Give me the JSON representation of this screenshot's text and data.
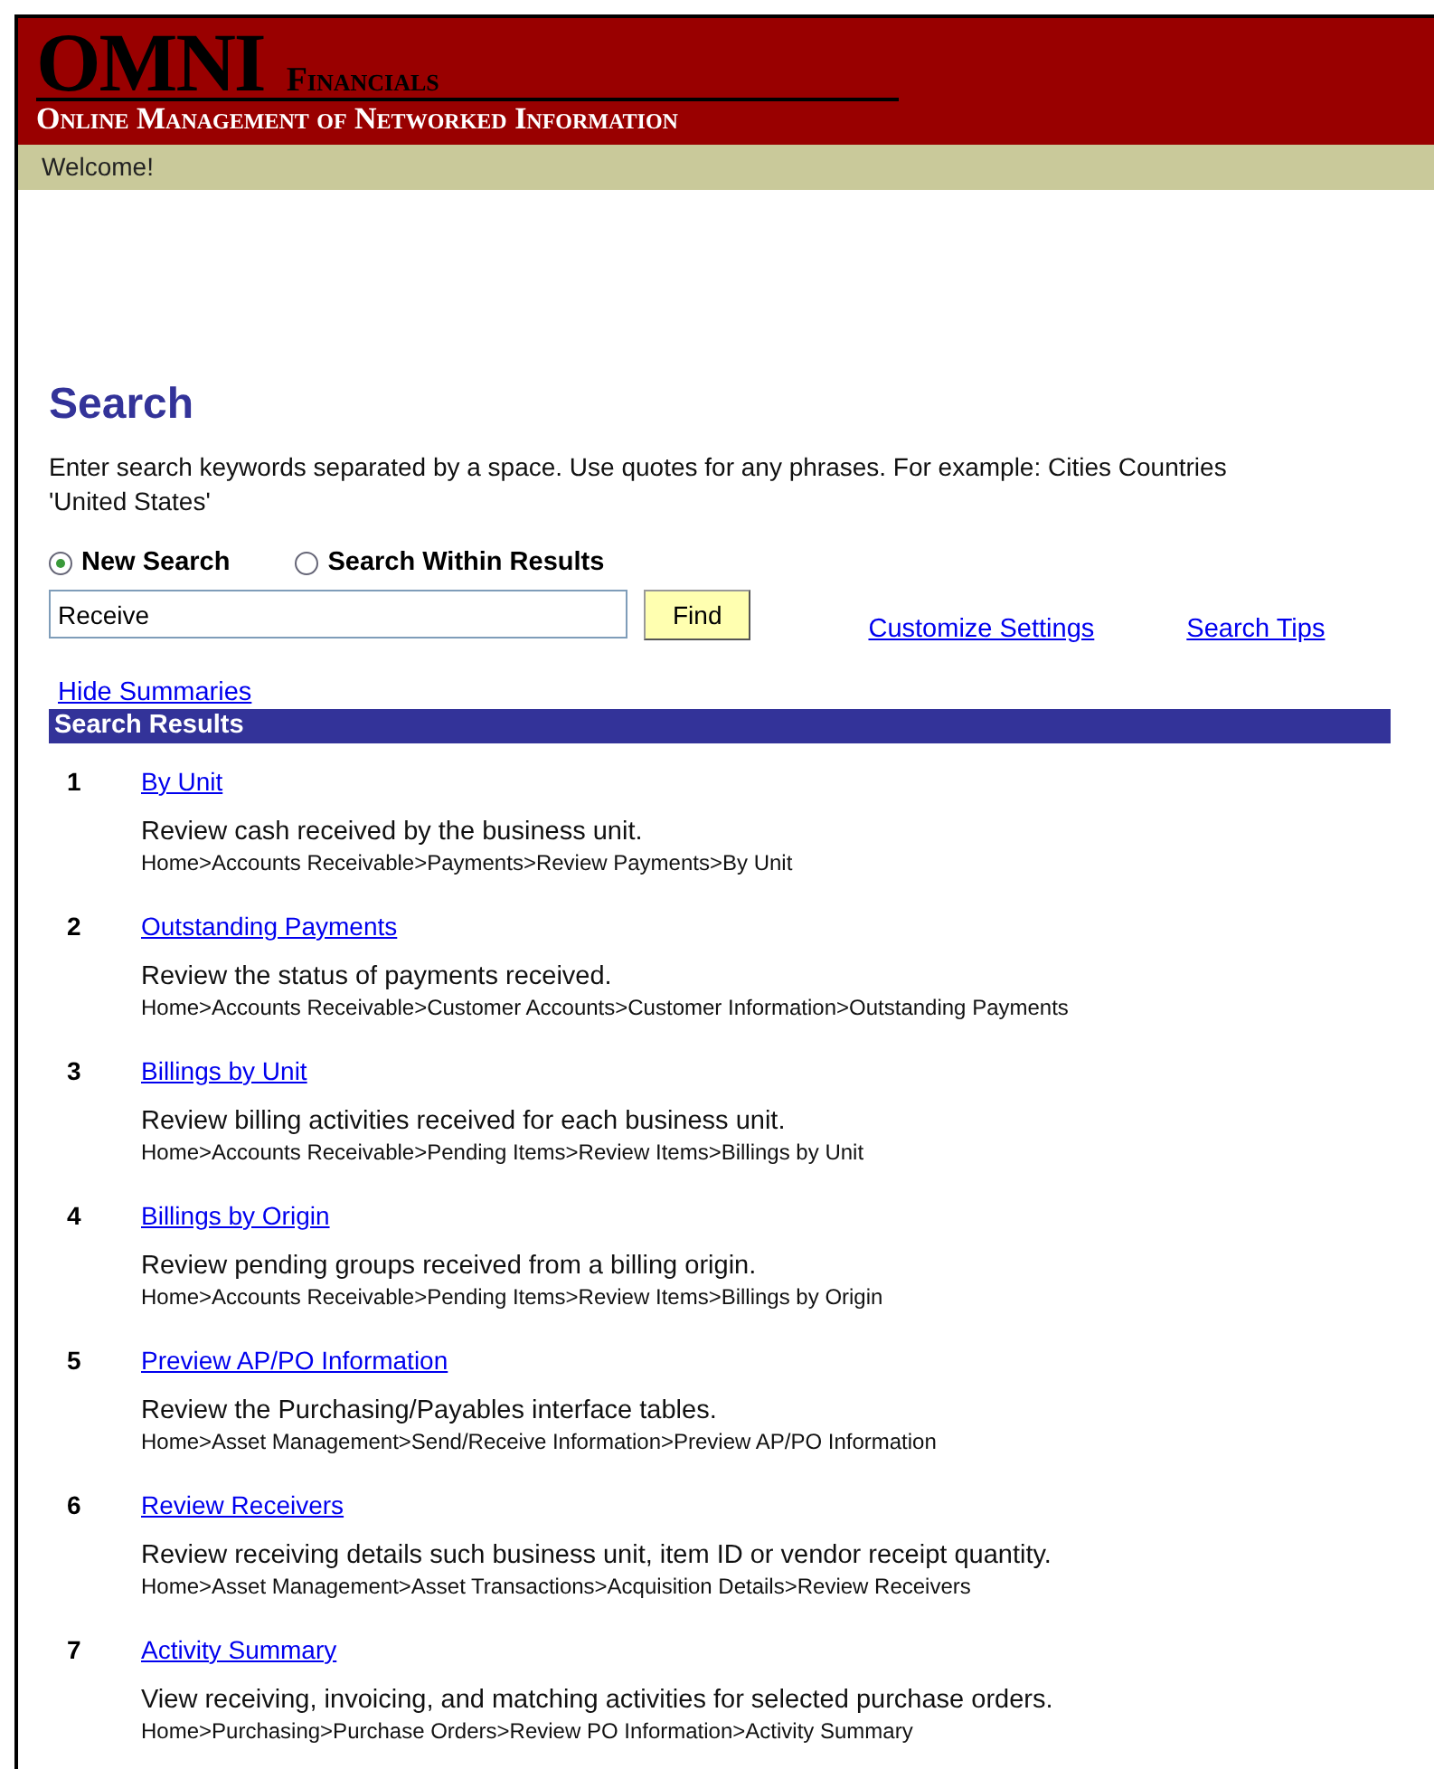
{
  "header": {
    "logo": "OMNI",
    "logo_suffix": "Financials",
    "tagline": "Online Management of Networked Information"
  },
  "welcome": "Welcome!",
  "search": {
    "title": "Search",
    "instructions": "Enter search keywords separated by a space. Use quotes for any phrases. For example: Cities Countries 'United States'",
    "modes": [
      {
        "label": "New Search",
        "selected": true
      },
      {
        "label": "Search Within Results",
        "selected": false
      }
    ],
    "value": "Receive",
    "find_button": "Find",
    "links": [
      "Customize Settings",
      "Search Tips"
    ]
  },
  "hide_summaries": "Hide Summaries",
  "results_header": "Search Results",
  "results": [
    {
      "number": "1",
      "title": "By Unit",
      "summary": "Review cash received by the business unit.",
      "path": "Home>Accounts Receivable>Payments>Review Payments>By Unit"
    },
    {
      "number": "2",
      "title": "Outstanding Payments",
      "summary": "Review the status of payments received.",
      "path": "Home>Accounts Receivable>Customer Accounts>Customer Information>Outstanding Payments"
    },
    {
      "number": "3",
      "title": "Billings by Unit",
      "summary": "Review billing activities received for each business unit.",
      "path": "Home>Accounts Receivable>Pending Items>Review Items>Billings by Unit"
    },
    {
      "number": "4",
      "title": "Billings by Origin",
      "summary": "Review pending groups received from a billing origin.",
      "path": "Home>Accounts Receivable>Pending Items>Review Items>Billings by Origin"
    },
    {
      "number": "5",
      "title": "Preview AP/PO Information",
      "summary": "Review the Purchasing/Payables interface tables.",
      "path": "Home>Asset Management>Send/Receive Information>Preview AP/PO Information"
    },
    {
      "number": "6",
      "title": "Review Receivers",
      "summary": "Review receiving details such business unit, item ID or vendor receipt quantity.",
      "path": "Home>Asset Management>Asset Transactions>Acquisition Details>Review Receivers"
    },
    {
      "number": "7",
      "title": "Activity Summary",
      "summary": "View receiving, invoicing, and matching activities for selected purchase orders.",
      "path": "Home>Purchasing>Purchase Orders>Review PO Information>Activity Summary"
    }
  ]
}
